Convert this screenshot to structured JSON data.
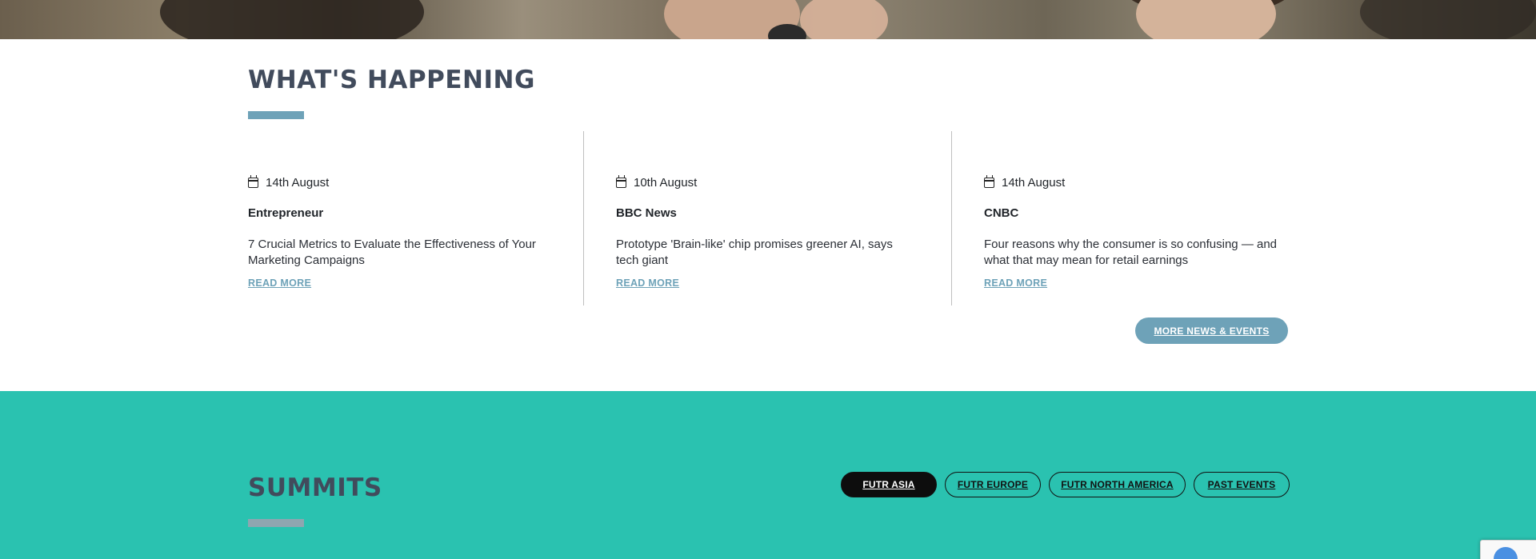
{
  "news": {
    "title": "WHAT'S HAPPENING",
    "cards": [
      {
        "date": "14th August",
        "source": "Entrepreneur",
        "headline": "7 Crucial Metrics to Evaluate the Effectiveness of Your Marketing Campaigns",
        "read_more": "READ MORE"
      },
      {
        "date": "10th August",
        "source": "BBC News",
        "headline": "Prototype 'Brain-like' chip promises greener AI, says tech giant",
        "read_more": "READ MORE"
      },
      {
        "date": "14th August",
        "source": "CNBC",
        "headline": "Four reasons why the consumer is so confusing — and what that may mean for retail earnings",
        "read_more": "READ MORE"
      }
    ],
    "more_button": "MORE NEWS & EVENTS"
  },
  "summits": {
    "title": "SUMMITS",
    "tabs": [
      {
        "label": "FUTR ASIA",
        "active": true
      },
      {
        "label": "FUTR EUROPE",
        "active": false
      },
      {
        "label": "FUTR NORTH AMERICA",
        "active": false
      },
      {
        "label": "PAST EVENTS",
        "active": false
      }
    ]
  },
  "colors": {
    "accent": "#6ea2b8",
    "summits_bg": "#2ac2b0",
    "heading": "#414b5c"
  },
  "icons": {
    "date": "calendar-icon",
    "badge": "recaptcha-icon"
  }
}
